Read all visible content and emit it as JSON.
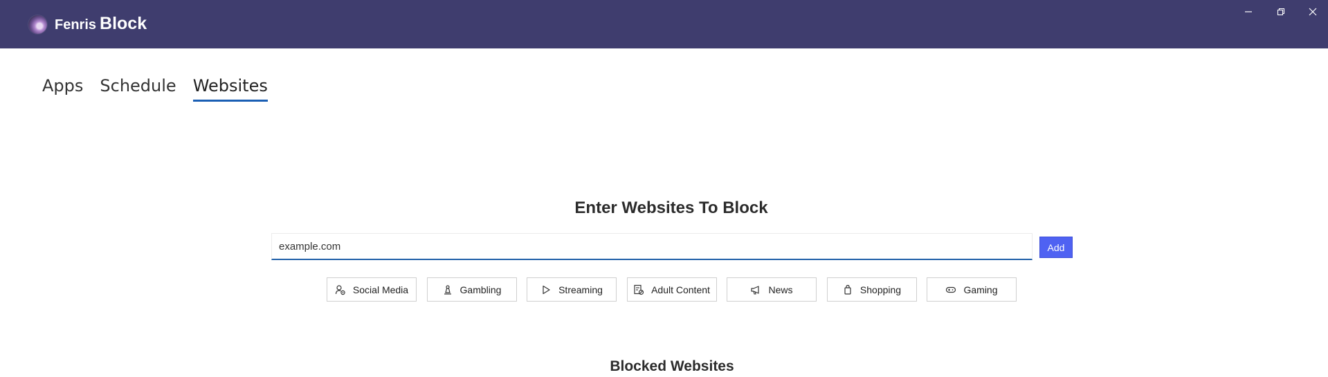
{
  "titlebar": {
    "app_name_part1": "Fenris",
    "app_name_part2": "Block",
    "logo_icon": "fenris-logo-icon",
    "background_color": "#3f3d6e"
  },
  "window_controls": {
    "minimize_icon": "minimize-icon",
    "restore_icon": "restore-icon",
    "close_icon": "close-icon"
  },
  "tabs": [
    {
      "label": "Apps",
      "active": false
    },
    {
      "label": "Schedule",
      "active": false
    },
    {
      "label": "Websites",
      "active": true
    }
  ],
  "main": {
    "heading": "Enter Websites To Block",
    "input": {
      "value": "",
      "placeholder": "example.com"
    },
    "add_label": "Add",
    "accent_color": "#4f62f2",
    "categories": [
      {
        "label": "Social Media",
        "icon": "people-settings-icon"
      },
      {
        "label": "Gambling",
        "icon": "chess-pawn-icon"
      },
      {
        "label": "Streaming",
        "icon": "play-icon"
      },
      {
        "label": "Adult Content",
        "icon": "restricted-doc-icon"
      },
      {
        "label": "News",
        "icon": "megaphone-icon"
      },
      {
        "label": "Shopping",
        "icon": "shopping-bag-icon"
      },
      {
        "label": "Gaming",
        "icon": "gamepad-icon"
      }
    ],
    "blocked_heading": "Blocked Websites"
  }
}
